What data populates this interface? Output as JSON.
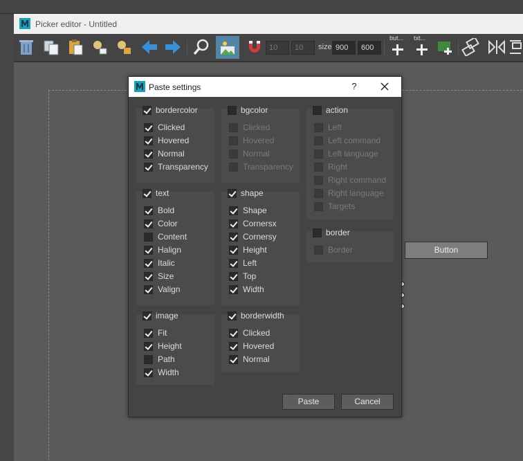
{
  "window": {
    "title": "Picker editor - Untitled"
  },
  "toolbar": {
    "pos_x": "10",
    "pos_y": "10",
    "size_label": "size",
    "size_w": "900",
    "size_h": "600",
    "add_button_label": "but...",
    "add_text_label": "txt..."
  },
  "canvas": {
    "button_label": "Button"
  },
  "dialog": {
    "title": "Paste settings",
    "help": "?",
    "paste_label": "Paste",
    "cancel_label": "Cancel",
    "groups": {
      "bordercolor": {
        "label": "bordercolor",
        "checked": true,
        "items": [
          {
            "label": "Clicked",
            "checked": true,
            "enabled": true
          },
          {
            "label": "Hovered",
            "checked": true,
            "enabled": true
          },
          {
            "label": "Normal",
            "checked": true,
            "enabled": true
          },
          {
            "label": "Transparency",
            "checked": true,
            "enabled": true
          }
        ]
      },
      "bgcolor": {
        "label": "bgcolor",
        "checked": false,
        "items": [
          {
            "label": "Clicked",
            "checked": false,
            "enabled": false
          },
          {
            "label": "Hovered",
            "checked": false,
            "enabled": false
          },
          {
            "label": "Normal",
            "checked": false,
            "enabled": false
          },
          {
            "label": "Transparency",
            "checked": false,
            "enabled": false
          }
        ]
      },
      "action": {
        "label": "action",
        "checked": false,
        "items": [
          {
            "label": "Left",
            "checked": false,
            "enabled": false
          },
          {
            "label": "Left command",
            "checked": false,
            "enabled": false
          },
          {
            "label": "Left language",
            "checked": false,
            "enabled": false
          },
          {
            "label": "Right",
            "checked": false,
            "enabled": false
          },
          {
            "label": "Right command",
            "checked": false,
            "enabled": false
          },
          {
            "label": "Right language",
            "checked": false,
            "enabled": false
          },
          {
            "label": "Targets",
            "checked": false,
            "enabled": false
          }
        ]
      },
      "text": {
        "label": "text",
        "checked": true,
        "items": [
          {
            "label": "Bold",
            "checked": true,
            "enabled": true
          },
          {
            "label": "Color",
            "checked": true,
            "enabled": true
          },
          {
            "label": "Content",
            "checked": false,
            "enabled": true
          },
          {
            "label": "Halign",
            "checked": true,
            "enabled": true
          },
          {
            "label": "Italic",
            "checked": true,
            "enabled": true
          },
          {
            "label": "Size",
            "checked": true,
            "enabled": true
          },
          {
            "label": "Valign",
            "checked": true,
            "enabled": true
          }
        ]
      },
      "shape": {
        "label": "shape",
        "checked": true,
        "items": [
          {
            "label": "Shape",
            "checked": true,
            "enabled": true
          },
          {
            "label": "Cornersx",
            "checked": true,
            "enabled": true
          },
          {
            "label": "Cornersy",
            "checked": true,
            "enabled": true
          },
          {
            "label": "Height",
            "checked": true,
            "enabled": true
          },
          {
            "label": "Left",
            "checked": true,
            "enabled": true
          },
          {
            "label": "Top",
            "checked": true,
            "enabled": true
          },
          {
            "label": "Width",
            "checked": true,
            "enabled": true
          }
        ]
      },
      "border": {
        "label": "border",
        "checked": false,
        "items": [
          {
            "label": "Border",
            "checked": false,
            "enabled": false
          }
        ]
      },
      "image": {
        "label": "image",
        "checked": true,
        "items": [
          {
            "label": "Fit",
            "checked": true,
            "enabled": true
          },
          {
            "label": "Height",
            "checked": true,
            "enabled": true
          },
          {
            "label": "Path",
            "checked": false,
            "enabled": true
          },
          {
            "label": "Width",
            "checked": true,
            "enabled": true
          }
        ]
      },
      "borderwidth": {
        "label": "borderwidth",
        "checked": true,
        "items": [
          {
            "label": "Clicked",
            "checked": true,
            "enabled": true
          },
          {
            "label": "Hovered",
            "checked": true,
            "enabled": true
          },
          {
            "label": "Normal",
            "checked": true,
            "enabled": true
          }
        ]
      }
    }
  },
  "colors": {
    "accent": "#5285a6",
    "dialog_bg": "#444444",
    "group_bg": "#4b4b4b"
  }
}
